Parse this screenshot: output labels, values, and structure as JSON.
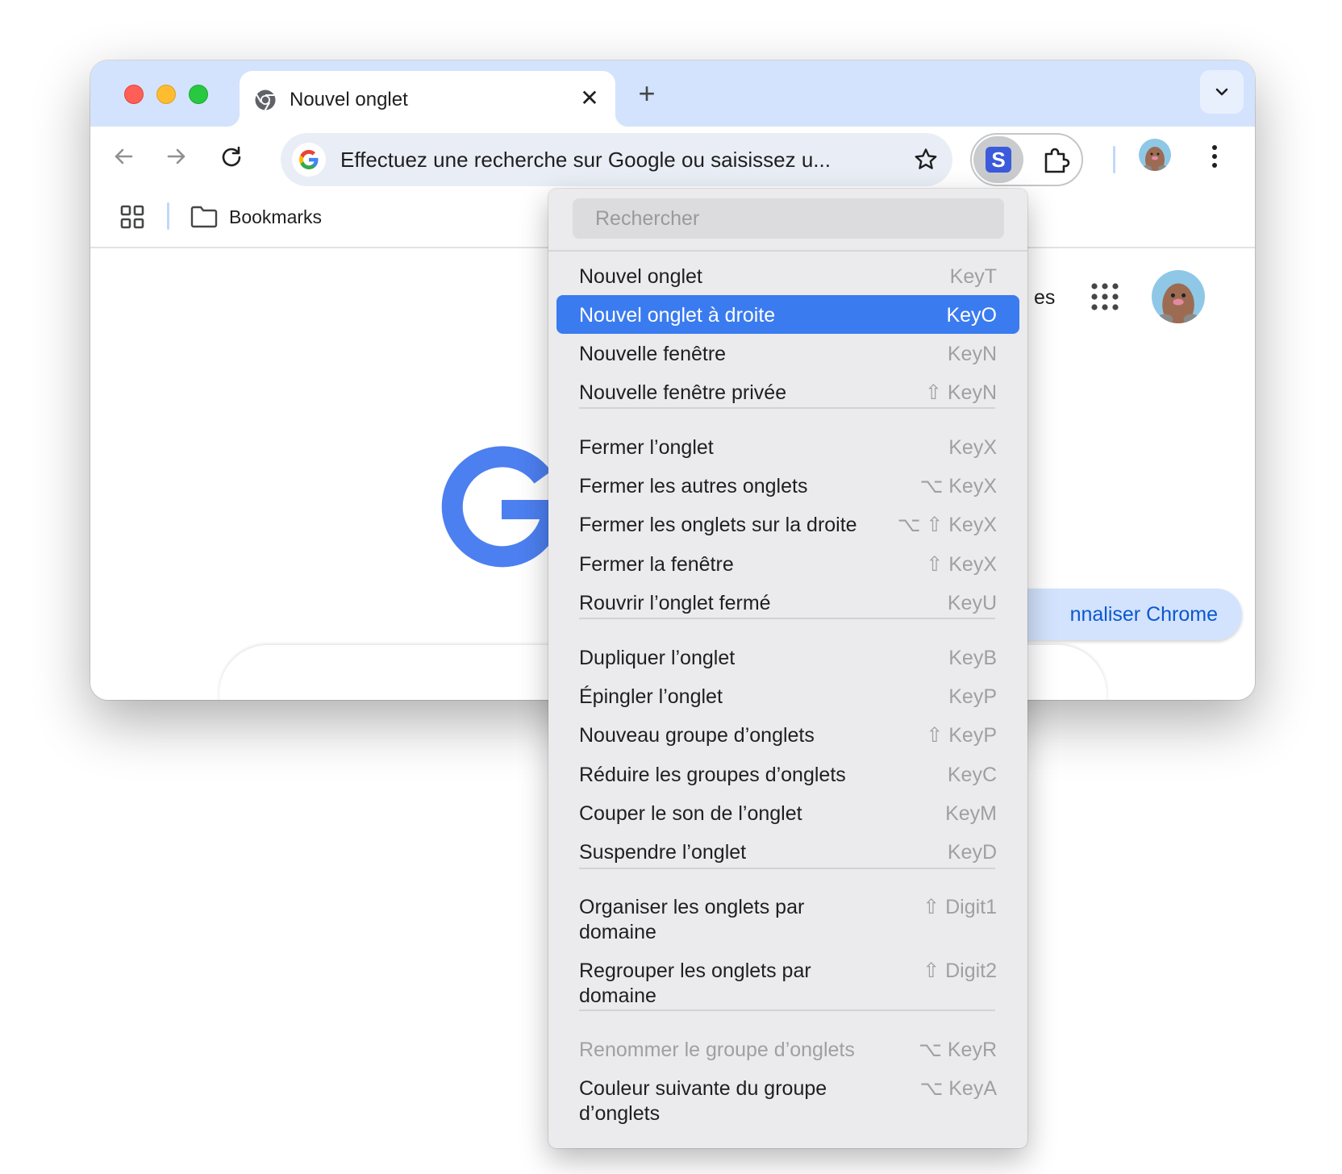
{
  "tab": {
    "title": "Nouvel onglet",
    "close_glyph": "✕"
  },
  "toolbar": {
    "omnibox_text": "Effectuez une recherche sur Google ou saisissez u...",
    "extension_letter": "S"
  },
  "bookmarks_bar": {
    "folder_label": "Bookmarks"
  },
  "page": {
    "right_text_fragment": "es",
    "customize_label": "nnaliser Chrome"
  },
  "menu": {
    "search_placeholder": "Rechercher",
    "items": [
      {
        "label": "Nouvel onglet",
        "shortcut": "KeyT"
      },
      {
        "label": "Nouvel onglet à droite",
        "shortcut": "KeyO",
        "state": "highlighted"
      },
      {
        "label": "Nouvelle fenêtre",
        "shortcut": "KeyN"
      },
      {
        "label": "Nouvelle fenêtre privée",
        "shortcut": "⇧ KeyN"
      },
      {
        "label": "Fermer l’onglet",
        "shortcut": "KeyX"
      },
      {
        "label": "Fermer les autres onglets",
        "shortcut": "⌥ KeyX"
      },
      {
        "label": "Fermer les onglets sur la droite",
        "shortcut": "⌥ ⇧ KeyX"
      },
      {
        "label": "Fermer la fenêtre",
        "shortcut": "⇧ KeyX"
      },
      {
        "label": "Rouvrir l’onglet fermé",
        "shortcut": "KeyU"
      },
      {
        "label": "Dupliquer l’onglet",
        "shortcut": "KeyB"
      },
      {
        "label": "Épingler l’onglet",
        "shortcut": "KeyP"
      },
      {
        "label": "Nouveau groupe d’onglets",
        "shortcut": "⇧ KeyP"
      },
      {
        "label": "Réduire les groupes d’onglets",
        "shortcut": "KeyC"
      },
      {
        "label": "Couper le son de l’onglet",
        "shortcut": "KeyM"
      },
      {
        "label": "Suspendre l’onglet",
        "shortcut": "KeyD"
      },
      {
        "label": "Organiser les onglets par domaine",
        "shortcut": "⇧ Digit1"
      },
      {
        "label": "Regrouper les onglets par domaine",
        "shortcut": "⇧ Digit2"
      },
      {
        "label": "Renommer le groupe d’onglets",
        "shortcut": "⌥ KeyR",
        "state": "disabled"
      },
      {
        "label": "Couleur suivante du groupe d’onglets",
        "shortcut": "⌥ KeyA"
      }
    ]
  },
  "colors": {
    "tabstrip": "#d3e3fd",
    "accent": "#0b57d0",
    "menu_highlight": "#3a7bef",
    "menu_background": "#ebebed"
  },
  "icons": {
    "back": "arrow-left-icon",
    "forward": "arrow-right-icon",
    "reload": "reload-icon",
    "star": "star-icon",
    "puzzle": "puzzle-icon",
    "kebab": "more-vertical-icon",
    "apps": "apps-grid-icon",
    "folder": "folder-icon",
    "tab_search": "chevron-down-icon"
  }
}
